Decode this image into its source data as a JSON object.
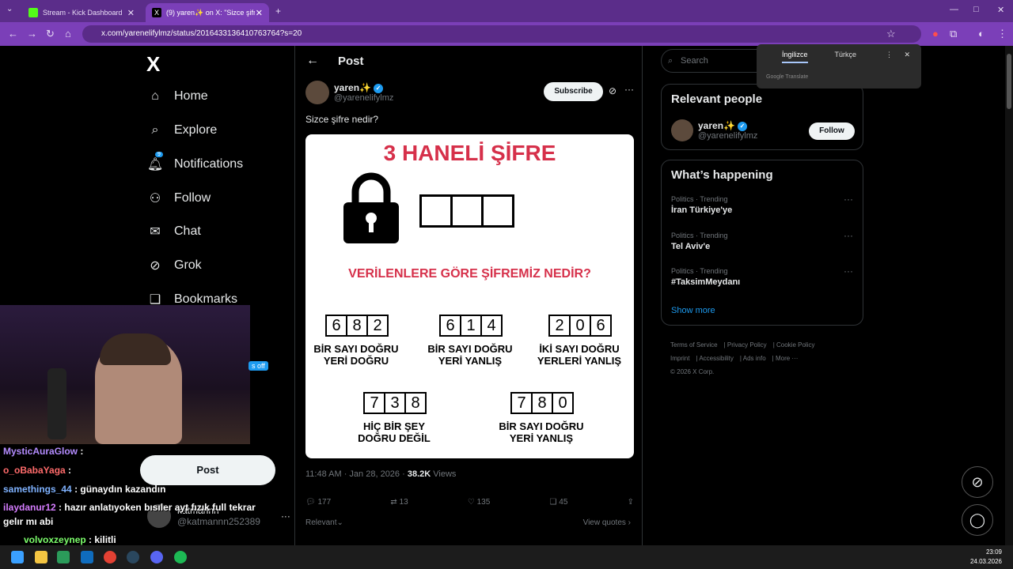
{
  "browser": {
    "tabs": [
      {
        "label": "Stream - Kick Dashboard",
        "active": false
      },
      {
        "label": "(9) yaren✨ on X: \"Sizce şifre n",
        "active": true
      }
    ],
    "url": "x.com/yarenelifylmz/status/2016433136410763764?s=20"
  },
  "nav": {
    "logo": "X",
    "items": [
      {
        "label": "Home",
        "icon": "home-icon"
      },
      {
        "label": "Explore",
        "icon": "search-icon"
      },
      {
        "label": "Notifications",
        "icon": "bell-icon",
        "badge": "9"
      },
      {
        "label": "Follow",
        "icon": "add-person-icon"
      },
      {
        "label": "Chat",
        "icon": "mail-icon"
      },
      {
        "label": "Grok",
        "icon": "grok-icon"
      },
      {
        "label": "Bookmarks",
        "icon": "bookmark-icon"
      }
    ],
    "post_label": "Post",
    "account": {
      "name": "katmannn",
      "handle": "@katmannn252389"
    }
  },
  "post": {
    "header_title": "Post",
    "author_name": "yaren✨",
    "author_handle": "@yarenelifylmz",
    "subscribe_label": "Subscribe",
    "text": "Sizce şifre nedir?",
    "image": {
      "title": "3 HANELİ ŞİFRE",
      "question": "VERİLENLERE GÖRE ŞİFREMİZ NEDİR?",
      "clues": [
        {
          "digits": [
            "6",
            "8",
            "2"
          ],
          "line1": "BİR SAYI DOĞRU",
          "line2": "YERİ DOĞRU"
        },
        {
          "digits": [
            "6",
            "1",
            "4"
          ],
          "line1": "BİR SAYI DOĞRU",
          "line2": "YERİ YANLIŞ"
        },
        {
          "digits": [
            "2",
            "0",
            "6"
          ],
          "line1": "İKİ SAYI DOĞRU",
          "line2": "YERLERİ YANLIŞ"
        },
        {
          "digits": [
            "7",
            "3",
            "8"
          ],
          "line1": "HİÇ BİR ŞEY",
          "line2": "DOĞRU DEĞİL"
        },
        {
          "digits": [
            "7",
            "8",
            "0"
          ],
          "line1": "BİR SAYI DOĞRU",
          "line2": "YERİ YANLIŞ"
        }
      ]
    },
    "time": "11:48 AM · Jan 28, 2026 ·",
    "views_count": "38.2K",
    "views_label": "Views",
    "actions": {
      "replies": "177",
      "reposts": "13",
      "likes": "135",
      "bookmarks": "45"
    },
    "relevant_label": "Relevant",
    "view_quotes_label": "View quotes"
  },
  "sidebar": {
    "search_placeholder": "Search",
    "relevant_people_title": "Relevant people",
    "person": {
      "name": "yaren✨",
      "handle": "@yarenelifylmz",
      "follow_label": "Follow"
    },
    "happening_title": "What’s happening",
    "trends": [
      {
        "category": "Politics · Trending",
        "topic": "İran Türkiye'ye"
      },
      {
        "category": "Politics · Trending",
        "topic": "Tel Aviv'e"
      },
      {
        "category": "Politics · Trending",
        "topic": "#TaksimMeydanı"
      }
    ],
    "show_more": "Show more",
    "footer": [
      "Terms of Service",
      "Privacy Policy",
      "Cookie Policy",
      "Imprint",
      "Accessibility",
      "Ads info",
      "More ···",
      "© 2026 X Corp."
    ]
  },
  "translate_popup": {
    "tab1": "İngilizce",
    "tab2": "Türkçe",
    "brand": "Google Translate"
  },
  "stream_overlay": {
    "off_badge": "s off",
    "chat": [
      {
        "user": "MysticAuraGlow",
        "msg": ":",
        "color": "#b48cff"
      },
      {
        "user": "o_oBabaYaga",
        "msg": ":",
        "color": "#ff6b6b"
      },
      {
        "user": "samethings_44",
        "msg": ": günaydın kazandın",
        "color": "#7fb2ff"
      },
      {
        "user": "ilaydanur12",
        "msg": ": hazır anlatıyoken bısıler ayt fızık full tekrar",
        "color": "#d67dff"
      },
      {
        "user": "",
        "msg": "gelır mı abi",
        "color": "#fff"
      },
      {
        "user": "volvoxzeynep",
        "msg": ": kilitli",
        "color": "#7cff6b"
      }
    ]
  },
  "taskbar": {
    "time": "23:09",
    "date": "24.03.2026"
  }
}
